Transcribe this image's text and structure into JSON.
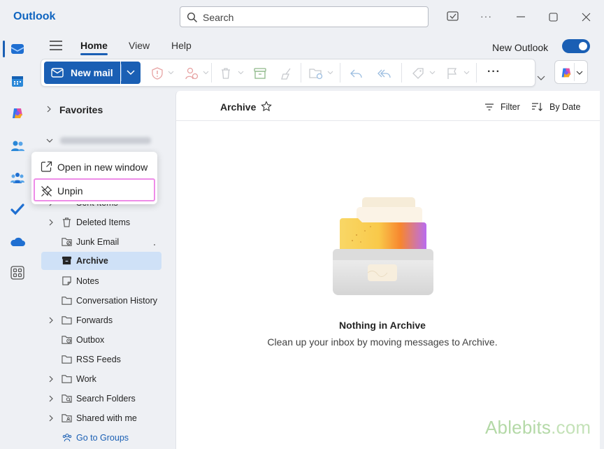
{
  "app": {
    "title": "Outlook"
  },
  "search": {
    "placeholder": "Search"
  },
  "ribbon": {
    "tabs": [
      {
        "label": "Home",
        "active": true
      },
      {
        "label": "View",
        "active": false
      },
      {
        "label": "Help",
        "active": false
      }
    ],
    "new_outlook_label": "New Outlook",
    "new_outlook_enabled": true,
    "new_mail_label": "New mail",
    "more_label": "···"
  },
  "rail": {
    "items": [
      "mail-icon",
      "calendar-icon",
      "copilot-icon",
      "people-icon",
      "groups-icon",
      "todo-icon",
      "onedrive-icon",
      "apps-icon"
    ],
    "active": "mail-icon"
  },
  "folders": {
    "favorites_label": "Favorites",
    "items": [
      {
        "label": "Sent Items",
        "icon": "send-icon",
        "expandable": true
      },
      {
        "label": "Deleted Items",
        "icon": "trash-icon",
        "expandable": true
      },
      {
        "label": "Junk Email",
        "icon": "junk-icon",
        "expandable": false
      },
      {
        "label": "Archive",
        "icon": "archive-icon",
        "expandable": false,
        "selected": true
      },
      {
        "label": "Notes",
        "icon": "notes-icon",
        "expandable": false
      },
      {
        "label": "Conversation History",
        "icon": "folder-icon",
        "expandable": false
      },
      {
        "label": "Forwards",
        "icon": "folder-icon",
        "expandable": true
      },
      {
        "label": "Outbox",
        "icon": "outbox-icon",
        "expandable": false
      },
      {
        "label": "RSS Feeds",
        "icon": "rss-icon",
        "expandable": false
      },
      {
        "label": "Work",
        "icon": "folder-icon",
        "expandable": true
      },
      {
        "label": "Search Folders",
        "icon": "search-folder-icon",
        "expandable": true
      },
      {
        "label": "Shared with me",
        "icon": "shared-folder-icon",
        "expandable": true
      },
      {
        "label": "Go to Groups",
        "icon": "groups-icon",
        "expandable": false
      }
    ]
  },
  "context_menu": {
    "open_new_window": "Open in new window",
    "unpin": "Unpin"
  },
  "list": {
    "folder_title": "Archive",
    "filter_label": "Filter",
    "sort_label": "By Date",
    "empty_title": "Nothing in Archive",
    "empty_subtitle": "Clean up your inbox by moving messages to Archive."
  },
  "watermark": {
    "text_a": "Ablebits",
    "text_b": ".com"
  },
  "colors": {
    "accent": "#1a5fb4",
    "selected": "#cfe1f7",
    "highlight": "#ee8ce8"
  }
}
